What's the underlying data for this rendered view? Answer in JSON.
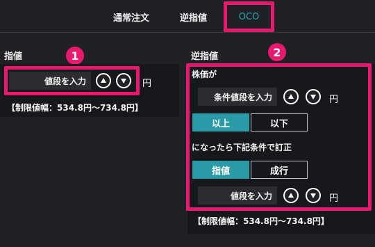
{
  "tabs": [
    {
      "label": "通常注文"
    },
    {
      "label": "逆指値"
    },
    {
      "label": "OCO"
    }
  ],
  "badges": [
    "1",
    "2"
  ],
  "limit_section": {
    "title": "指値",
    "price_placeholder": "値段を入力",
    "unit": "円",
    "limit_range": "【制限値幅：534.8円～734.8円】"
  },
  "stop_section": {
    "title": "逆指値",
    "condition_label": "株価が",
    "condition_placeholder": "条件値段を入力",
    "unit": "円",
    "direction_options": [
      {
        "label": "以上",
        "selected": true
      },
      {
        "label": "以下",
        "selected": false
      }
    ],
    "then_label": "になったら下記条件で訂正",
    "order_type_options": [
      {
        "label": "指値",
        "selected": true
      },
      {
        "label": "成行",
        "selected": false
      }
    ],
    "price_placeholder": "値段を入力",
    "price_unit": "円",
    "limit_range": "【制限値幅：534.8円～734.8円】"
  },
  "colors": {
    "highlight": "#e8196f",
    "accent": "#2b9aa7",
    "background": "#1f2124"
  },
  "icons": {
    "up": "triangle-up-icon",
    "down": "triangle-down-icon"
  }
}
